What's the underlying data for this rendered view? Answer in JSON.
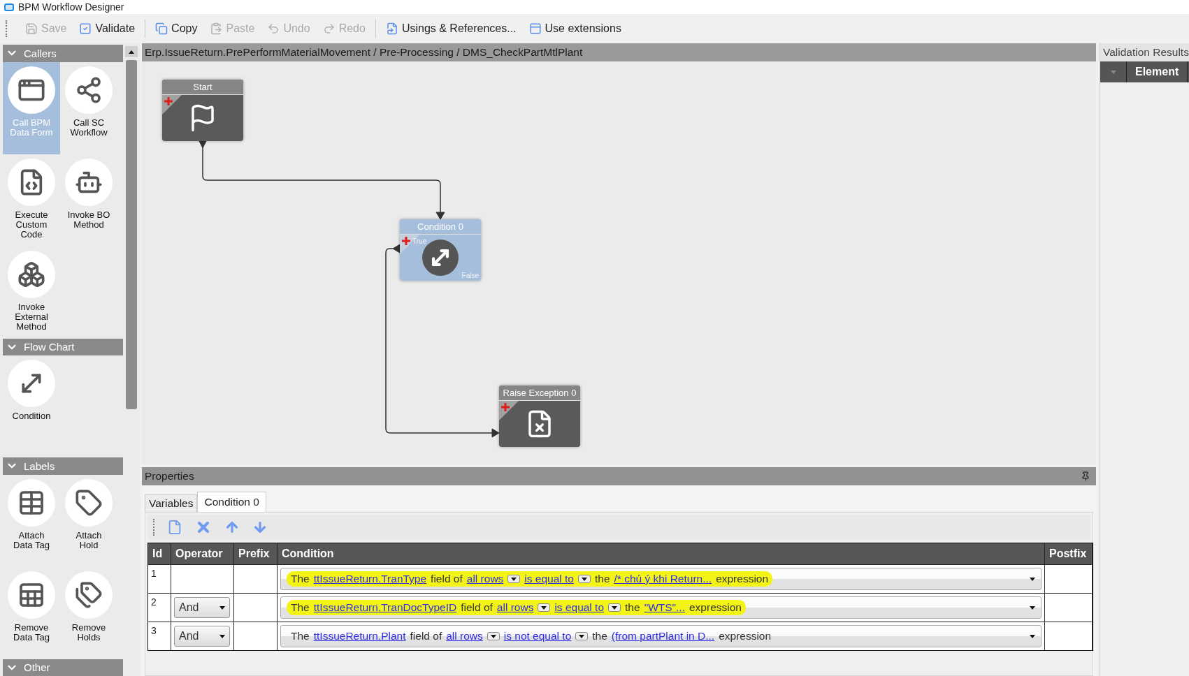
{
  "window": {
    "title": "BPM Workflow Designer"
  },
  "toolbar": {
    "groups": [
      [
        {
          "label": "Save",
          "kind": "save",
          "disabled": true
        },
        {
          "label": "Validate",
          "kind": "validate",
          "disabled": false
        }
      ],
      [
        {
          "label": "Copy",
          "kind": "copy",
          "disabled": false
        },
        {
          "label": "Paste",
          "kind": "paste",
          "disabled": true
        },
        {
          "label": "Undo",
          "kind": "undo",
          "disabled": true
        },
        {
          "label": "Redo",
          "kind": "redo",
          "disabled": true
        }
      ],
      [
        {
          "label": "Usings & References...",
          "kind": "usings",
          "disabled": false
        },
        {
          "label": "Use extensions",
          "kind": "extensions",
          "disabled": false
        }
      ]
    ]
  },
  "palette": {
    "sections": [
      {
        "title": "Callers",
        "expanded": true,
        "items": [
          {
            "label": "Call BPM Data Form",
            "kind": "form",
            "selected": true
          },
          {
            "label": "Call SC Workflow",
            "kind": "workflow",
            "selected": false
          },
          {
            "label": "Execute Custom Code",
            "kind": "code",
            "selected": false
          },
          {
            "label": "Invoke BO Method",
            "kind": "bo-method",
            "selected": false
          },
          {
            "label": "Invoke External Method",
            "kind": "external",
            "selected": false
          }
        ]
      },
      {
        "title": "Flow Chart",
        "expanded": true,
        "items": [
          {
            "label": "Condition",
            "kind": "condition",
            "selected": false
          }
        ]
      },
      {
        "title": "Labels",
        "expanded": true,
        "items": [
          {
            "label": "Attach Data Tag",
            "kind": "data-tag",
            "selected": false
          },
          {
            "label": "Attach Hold",
            "kind": "hold",
            "selected": false
          },
          {
            "label": "Remove Data Tag",
            "kind": "remove-tag",
            "selected": false
          },
          {
            "label": "Remove Holds",
            "kind": "remove-hold",
            "selected": false
          }
        ]
      },
      {
        "title": "Other",
        "expanded": true
      }
    ]
  },
  "canvas": {
    "breadcrumb": "Erp.IssueReturn.PrePerformMaterialMovement / Pre-Processing / DMS_CheckPartMtlPlant",
    "nodes": [
      {
        "kind": "start",
        "title": "Start",
        "selected": false
      },
      {
        "kind": "condition",
        "title": "Condition 0",
        "selected": true,
        "true_label": "True",
        "false_label": "False"
      },
      {
        "kind": "exception",
        "title": "Raise Exception 0",
        "selected": false
      }
    ]
  },
  "properties": {
    "title": "Properties",
    "tabs": [
      {
        "label": "Variables",
        "selected": false
      },
      {
        "label": "Condition 0",
        "selected": true
      }
    ],
    "table": {
      "columns": [
        "Id",
        "Operator",
        "Prefix",
        "Condition",
        "Postfix"
      ],
      "rows": [
        {
          "id": "1",
          "operator": null,
          "highlighted": true,
          "parts": [
            {
              "kind": "text",
              "text": "The"
            },
            {
              "kind": "link",
              "text": "ttIssueReturn.TranType"
            },
            {
              "kind": "text",
              "text": "field of"
            },
            {
              "kind": "choice",
              "text": "all rows"
            },
            {
              "kind": "choice",
              "text": "is equal to"
            },
            {
              "kind": "text",
              "text": "the"
            },
            {
              "kind": "link",
              "text": "/* chú ý khi Return..."
            },
            {
              "kind": "text",
              "text": "expression"
            }
          ]
        },
        {
          "id": "2",
          "operator": "And",
          "highlighted": true,
          "parts": [
            {
              "kind": "text",
              "text": "The"
            },
            {
              "kind": "link",
              "text": "ttIssueReturn.TranDocTypeID"
            },
            {
              "kind": "text",
              "text": "field of"
            },
            {
              "kind": "choice",
              "text": "all rows"
            },
            {
              "kind": "choice",
              "text": "is equal to"
            },
            {
              "kind": "text",
              "text": "the"
            },
            {
              "kind": "link",
              "text": "\"WTS\"..."
            },
            {
              "kind": "text",
              "text": "expression"
            }
          ]
        },
        {
          "id": "3",
          "operator": "And",
          "highlighted": false,
          "parts": [
            {
              "kind": "text",
              "text": "The"
            },
            {
              "kind": "link",
              "text": "ttIssueReturn.Plant"
            },
            {
              "kind": "text",
              "text": "field of"
            },
            {
              "kind": "choice",
              "text": "all rows"
            },
            {
              "kind": "choice",
              "text": "is not equal to"
            },
            {
              "kind": "text",
              "text": "the"
            },
            {
              "kind": "link",
              "text": "(from partPlant in D..."
            },
            {
              "kind": "text",
              "text": "expression"
            }
          ]
        }
      ]
    }
  },
  "validation": {
    "title": "Validation Results",
    "columns": [
      "Element"
    ]
  }
}
